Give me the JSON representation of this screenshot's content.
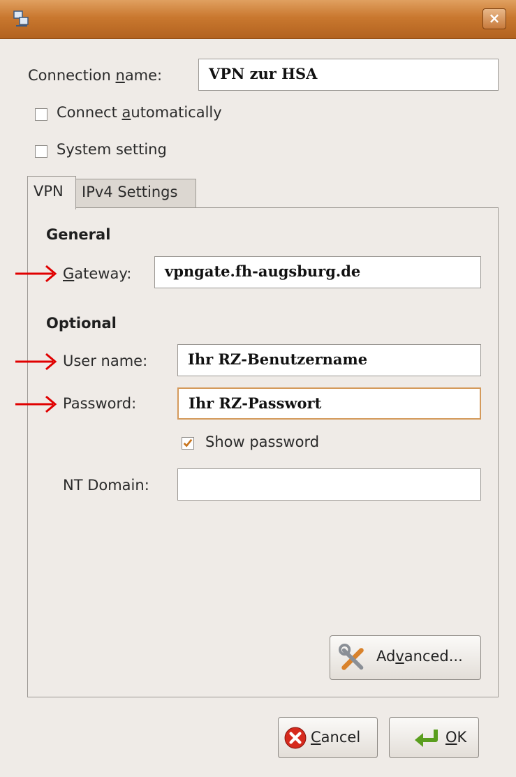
{
  "window": {
    "title": "",
    "close_label": "×"
  },
  "connection": {
    "name_label": "Connection name:",
    "name_value": "VPN zur HSA",
    "connect_auto_label": "Connect automatically",
    "connect_auto_checked": false,
    "system_setting_label": "System setting",
    "system_setting_checked": false
  },
  "tabs": [
    {
      "label": "VPN",
      "active": true
    },
    {
      "label": "IPv4 Settings",
      "active": false
    }
  ],
  "vpn": {
    "general_heading": "General",
    "gateway_label": "Gateway:",
    "gateway_value": "vpngate.fh-augsburg.de",
    "optional_heading": "Optional",
    "username_label": "User name:",
    "username_value": "Ihr RZ-Benutzername",
    "password_label": "Password:",
    "password_value": "Ihr RZ-Passwort",
    "show_password_label": "Show password",
    "show_password_checked": true,
    "nt_domain_label": "NT Domain:",
    "nt_domain_value": "",
    "advanced_label": "Advanced..."
  },
  "buttons": {
    "cancel_label": "Cancel",
    "ok_label": "OK"
  },
  "colors": {
    "titlebar": "#c9782f",
    "arrow": "#e00000",
    "focus_border": "#d49a5b",
    "checkmark": "#c8741c"
  },
  "icons": [
    "network-connections-icon",
    "close-icon",
    "advanced-tools-icon",
    "cancel-icon",
    "ok-enter-icon"
  ]
}
